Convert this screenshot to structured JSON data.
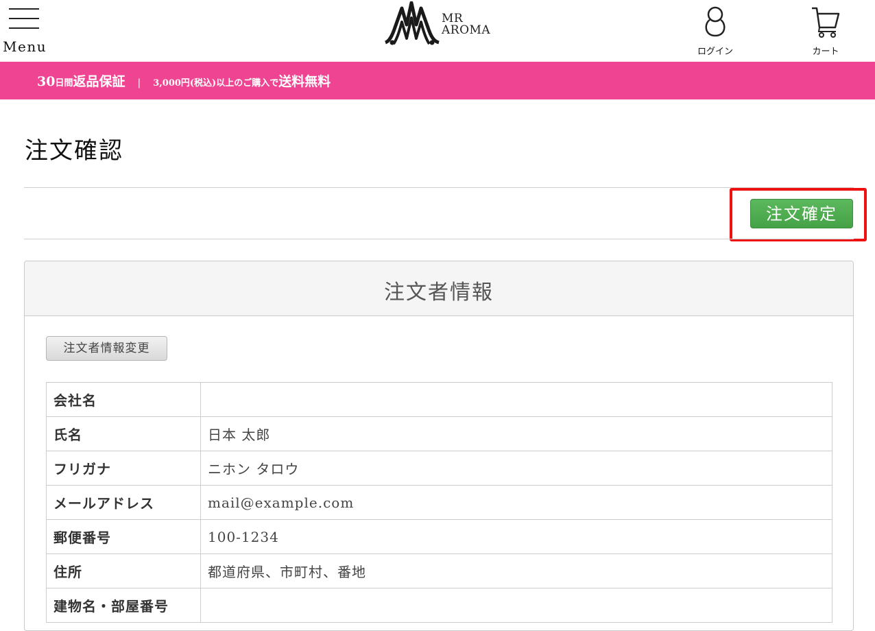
{
  "header": {
    "menu_label": "Menu",
    "logo_line1": "MR",
    "logo_line2": "AROMA",
    "login_label": "ログイン",
    "cart_label": "カート"
  },
  "banner": {
    "days_number": "30",
    "days_unit": "日間",
    "guarantee": "返品保証",
    "separator": "|",
    "purchase_text": "3,000円(税込)以上のご購入で",
    "free_shipping": "送料無料"
  },
  "page_title": "注文確認",
  "confirm_button": "注文確定",
  "panel": {
    "title": "注文者情報",
    "edit_button": "注文者情報変更",
    "rows": [
      {
        "label": "会社名",
        "value": ""
      },
      {
        "label": "氏名",
        "value": "日本 太郎"
      },
      {
        "label": "フリガナ",
        "value": "ニホン タロウ"
      },
      {
        "label": "メールアドレス",
        "value": "mail@example.com"
      },
      {
        "label": "郵便番号",
        "value": "100-1234"
      },
      {
        "label": "住所",
        "value": "都道府県、市町村、番地"
      },
      {
        "label": "建物名・部屋番号",
        "value": ""
      }
    ]
  },
  "colors": {
    "banner": "#ef4491",
    "confirm_button": "#5cb85c",
    "highlight": "#ee1111"
  },
  "icons": [
    "menu-icon",
    "user-icon",
    "cart-icon"
  ]
}
